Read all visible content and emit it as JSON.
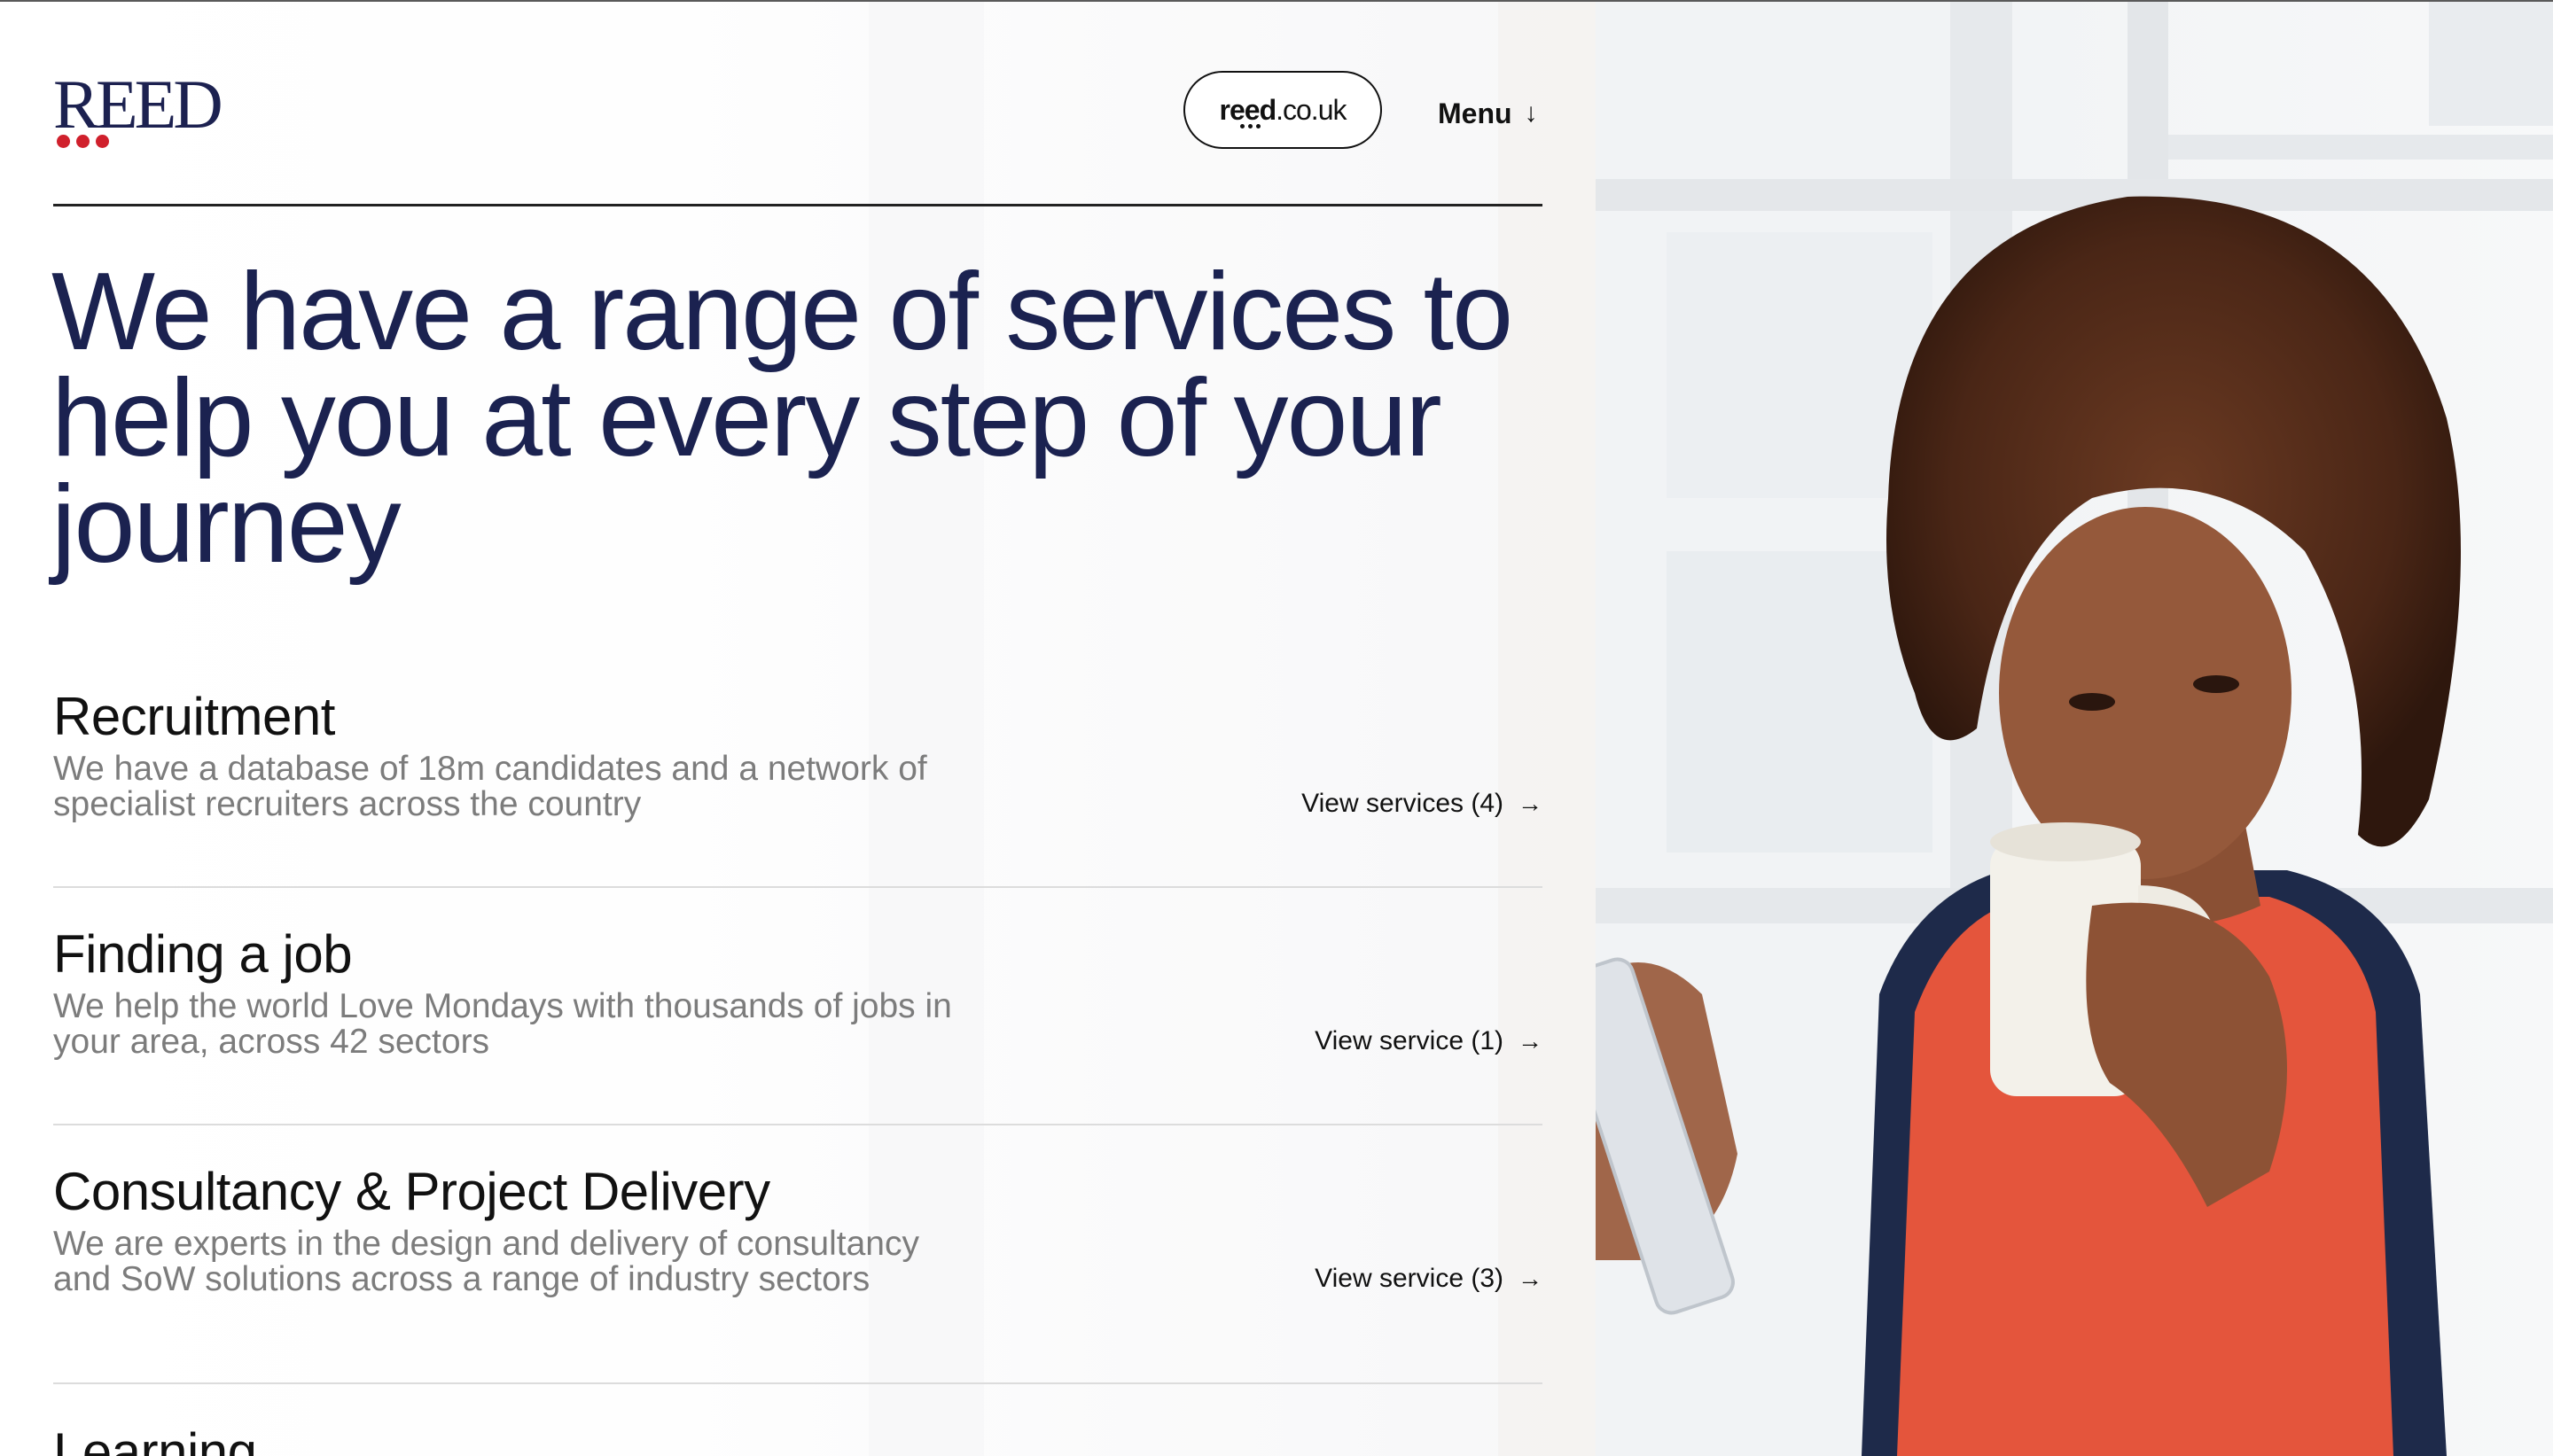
{
  "brand": {
    "logo_text": "REED",
    "logo_color": "#1c2150",
    "dot_color": "#d0202c"
  },
  "header": {
    "site_link_bold": "reed",
    "site_link_rest": ".co.uk",
    "menu_label": "Menu",
    "menu_arrow": "↓"
  },
  "hero": {
    "headline": "We have a range of services to help you at every step of your journey",
    "headline_color": "#1b2250"
  },
  "services": [
    {
      "title": "Recruitment",
      "description": "We have a database of 18m candidates and a network of specialist recruiters across the country",
      "link_label": "View services (4)"
    },
    {
      "title": "Finding a job",
      "description": "We help the world Love Mondays with thousands of jobs in your area, across 42 sectors",
      "link_label": "View service (1)"
    },
    {
      "title": "Consultancy & Project Delivery",
      "description": "We are experts in the design and delivery of consultancy and SoW solutions across a range of industry sectors",
      "link_label": "View service (3)"
    },
    {
      "title": "Learning"
    }
  ],
  "icons": {
    "link_arrow": "→"
  },
  "photo": {
    "subject": "woman-drinking-coffee-holding-phone"
  }
}
